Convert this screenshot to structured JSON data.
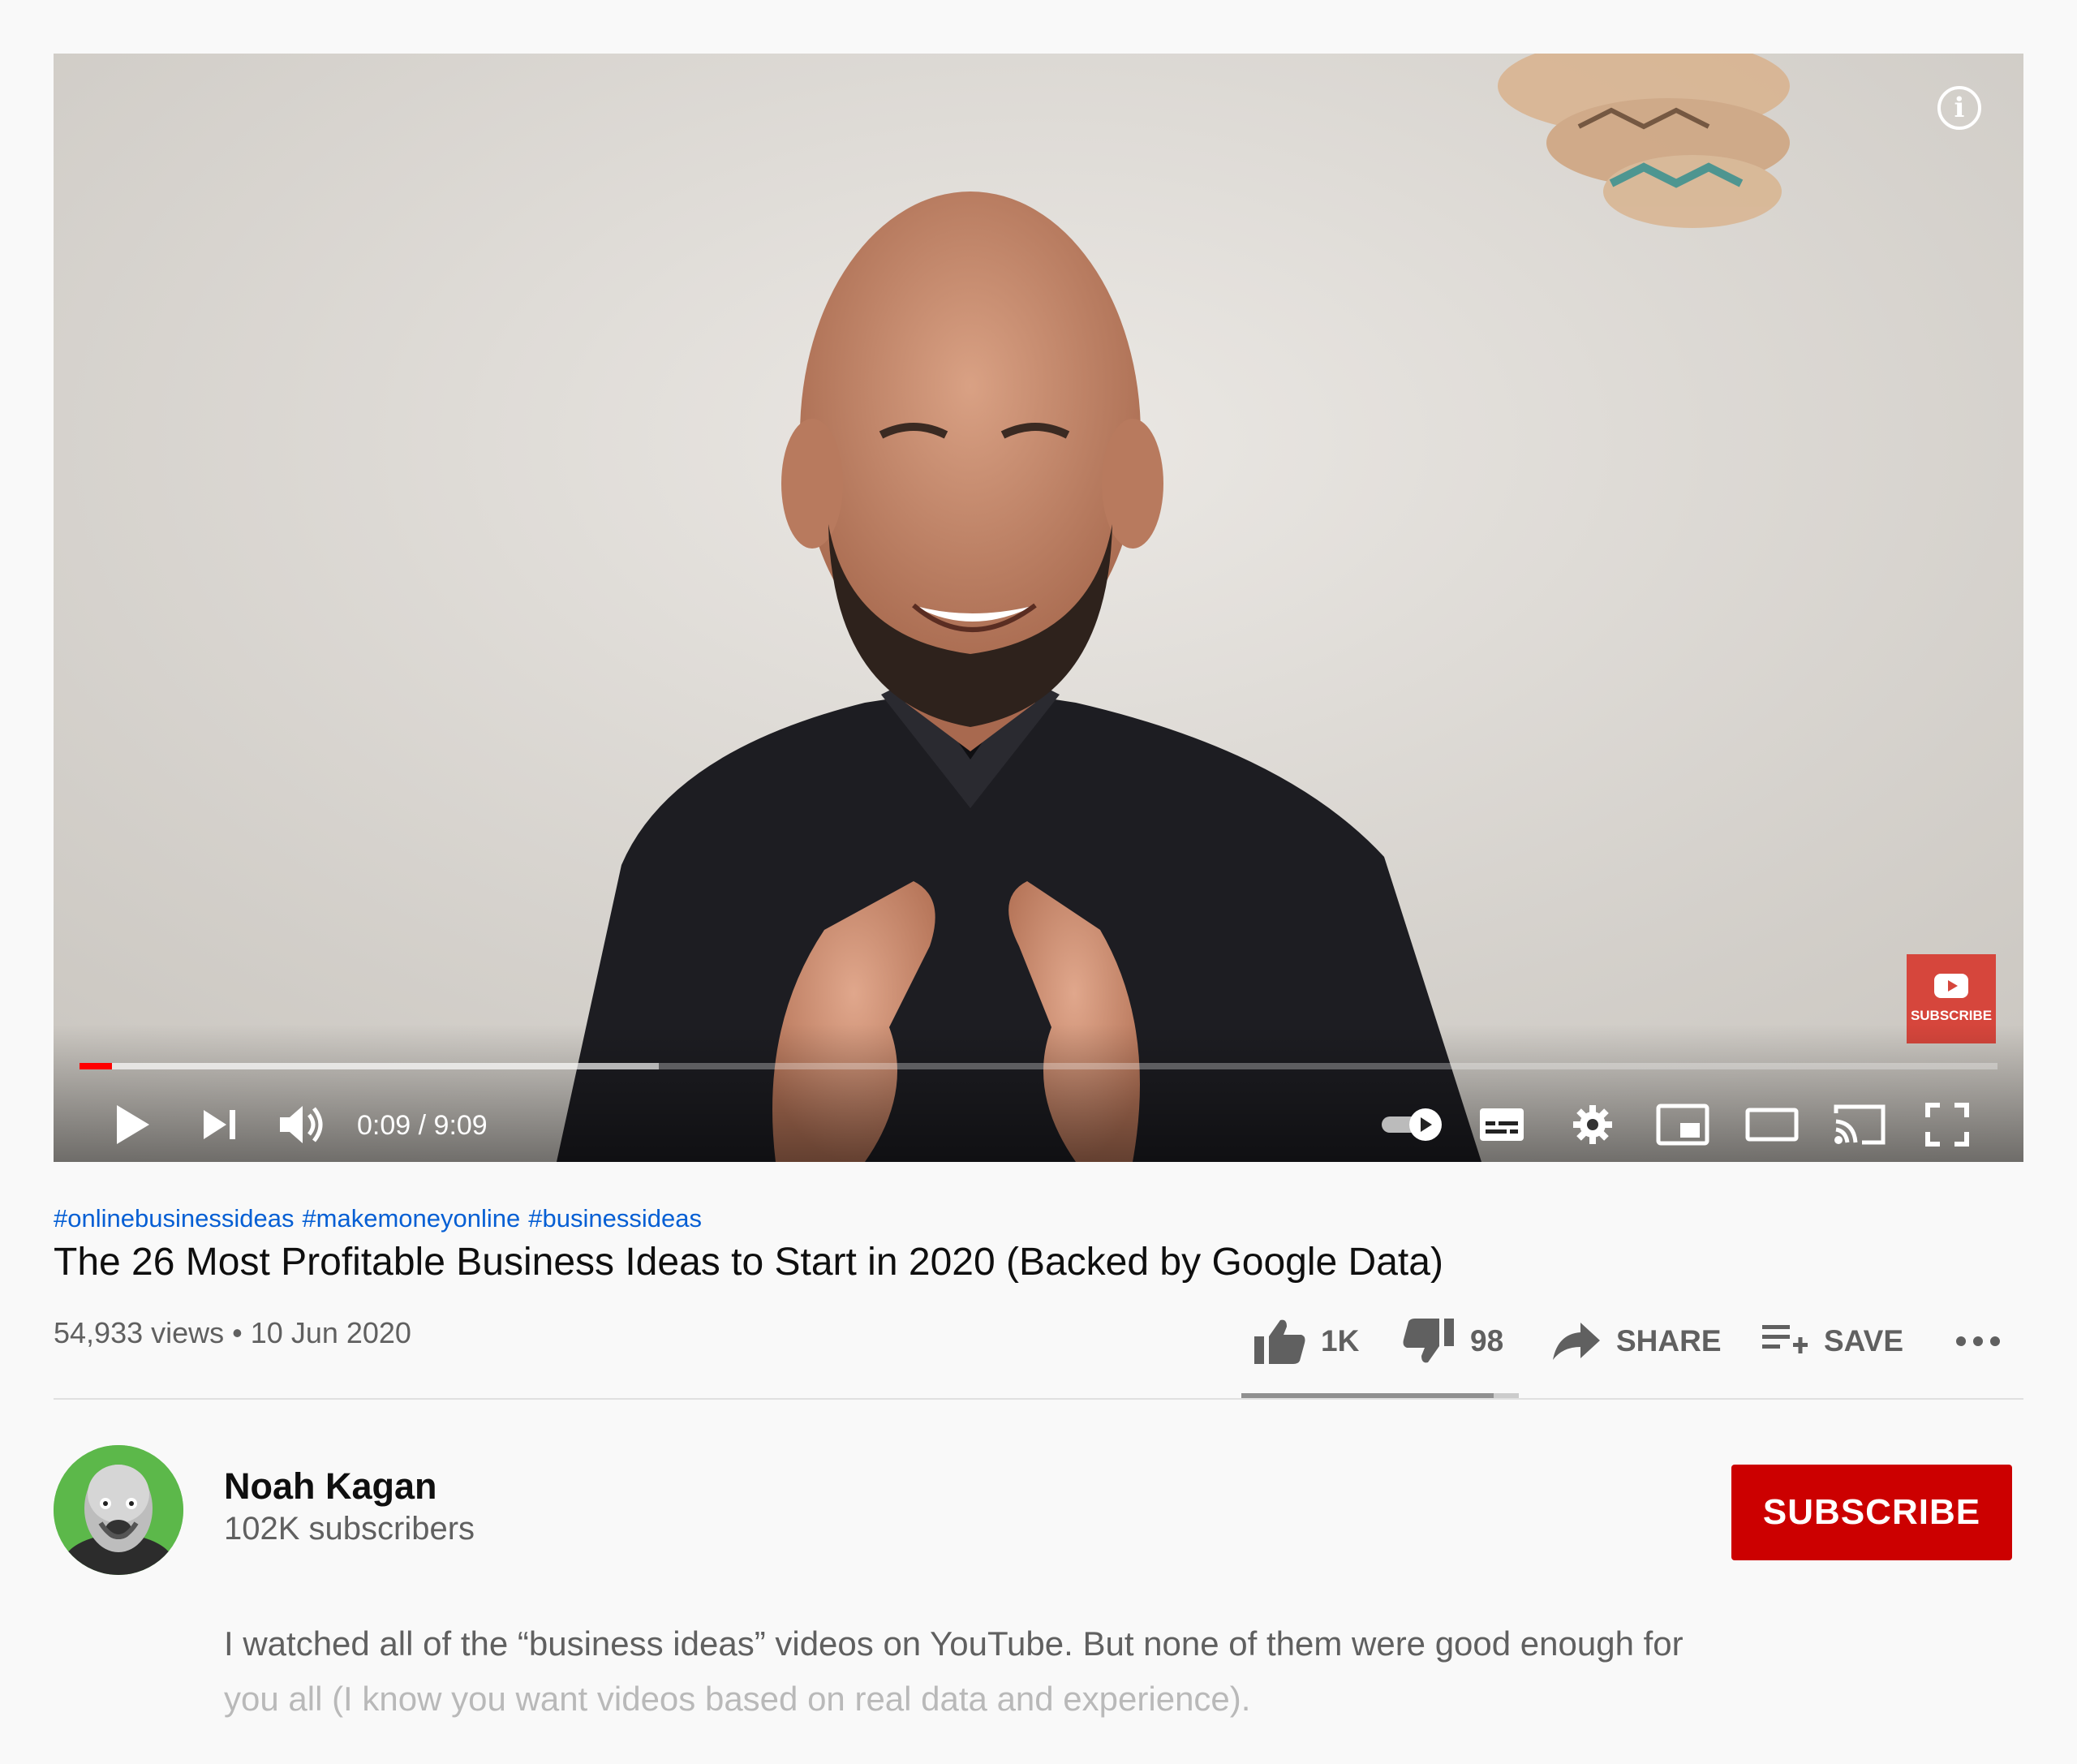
{
  "player": {
    "time_current": "0:09",
    "time_total": "9:09",
    "time_separator": "/",
    "progress_played": 0.017,
    "progress_buffered": 0.302,
    "watermark_label": "SUBSCRIBE",
    "info_label": "i",
    "colors": {
      "progress": "#ff0000",
      "watermark": "#d6463c"
    }
  },
  "video": {
    "hashtags": [
      "#onlinebusinessideas",
      "#makemoneyonline",
      "#businessideas"
    ],
    "title": "The 26 Most Profitable Business Ideas to Start in 2020 (Backed by Google Data)",
    "views": "54,933 views",
    "separator": "•",
    "date": "10 Jun 2020"
  },
  "actions": {
    "like_count": "1K",
    "dislike_count": "98",
    "share_label": "SHARE",
    "save_label": "SAVE",
    "like_ratio": 0.91
  },
  "channel": {
    "name": "Noah Kagan",
    "subscribers": "102K subscribers",
    "subscribe_label": "SUBSCRIBE",
    "subscribe_color": "#cc0000"
  },
  "description": {
    "line1": "I watched all of the “business ideas” videos on YouTube. But none of them were good enough for",
    "line2": "you all (I know you want videos based on real data and experience)."
  },
  "icons": [
    "info-icon",
    "youtube-play-icon",
    "play-icon",
    "next-icon",
    "volume-icon",
    "autoplay-toggle-icon",
    "subtitles-icon",
    "settings-gear-icon",
    "miniplayer-icon",
    "theater-mode-icon",
    "cast-icon",
    "fullscreen-icon",
    "thumbs-up-icon",
    "thumbs-down-icon",
    "share-arrow-icon",
    "playlist-add-icon",
    "more-dots-icon"
  ]
}
